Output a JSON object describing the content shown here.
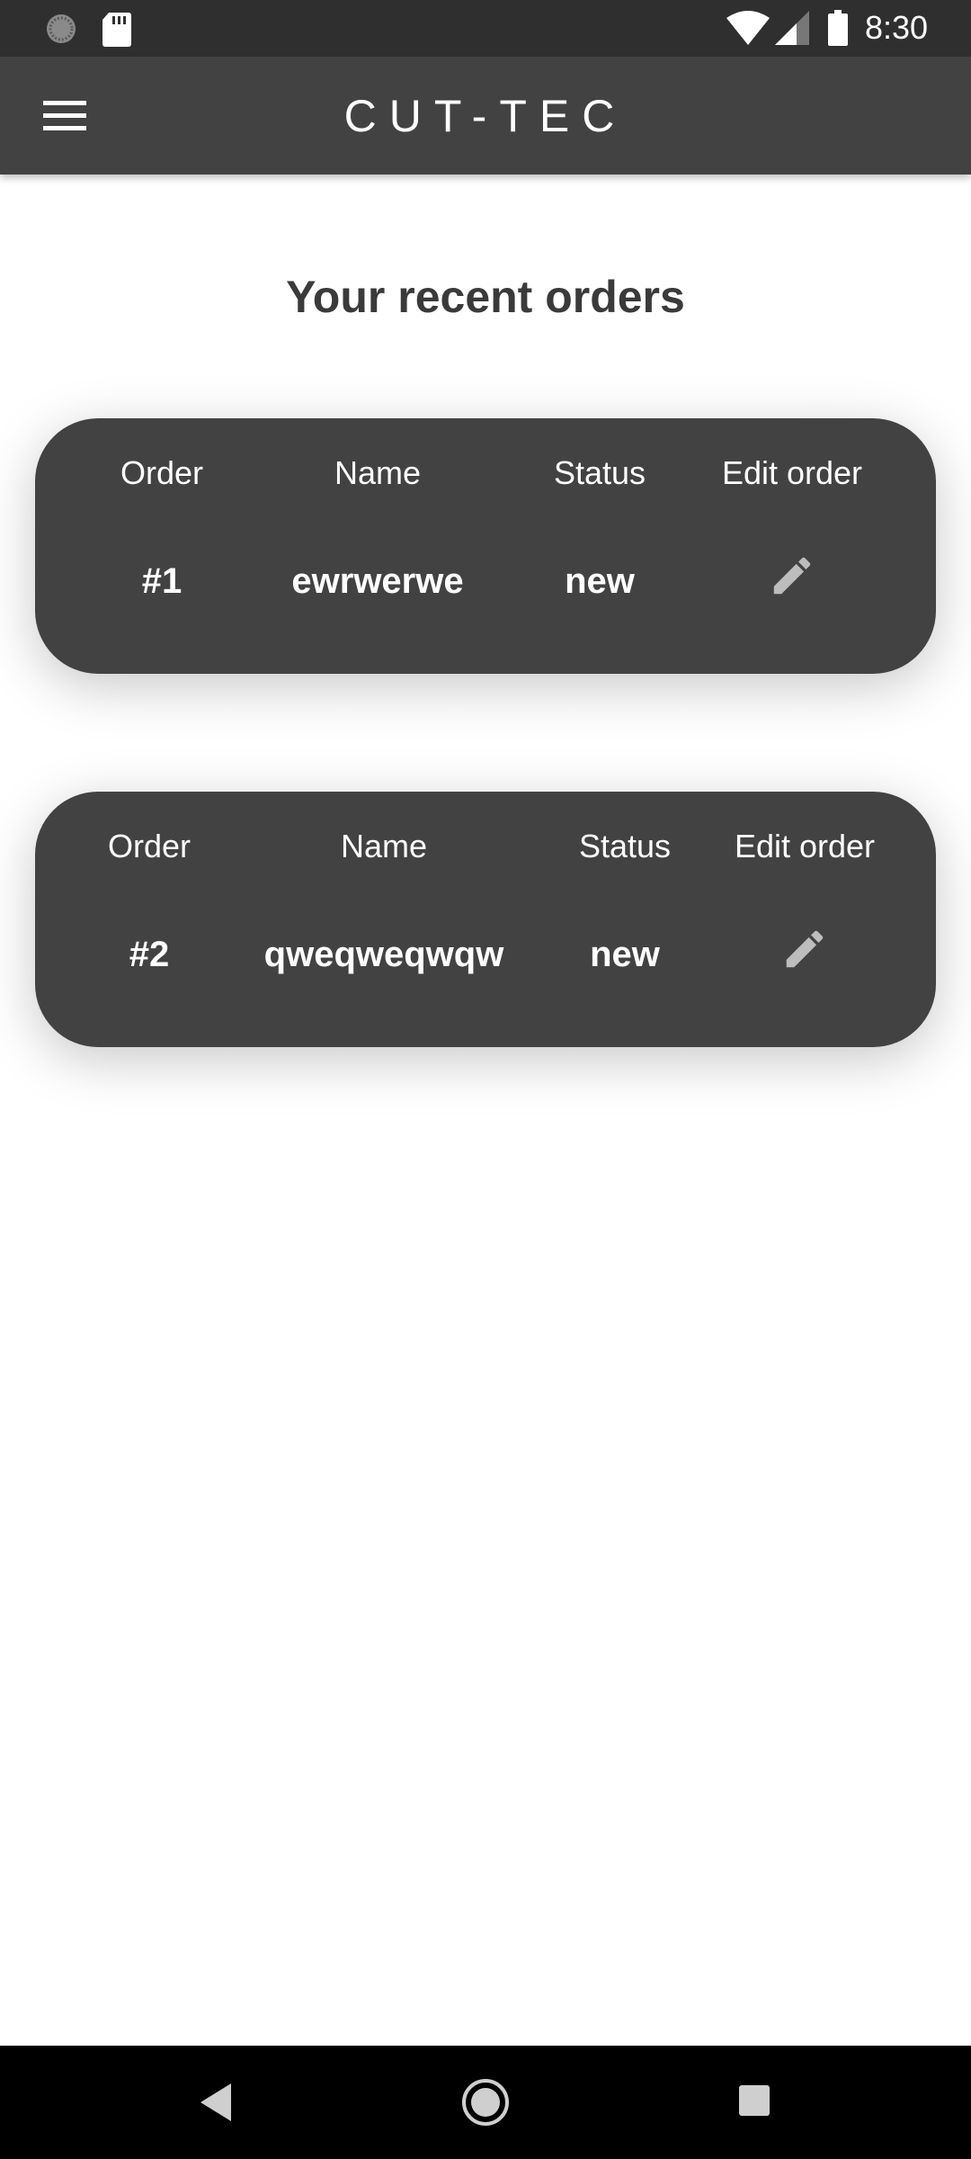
{
  "status_bar": {
    "time": "8:30"
  },
  "app_bar": {
    "title": "CUT-TEC",
    "menu_icon": "hamburger-menu-icon"
  },
  "page": {
    "heading": "Your recent orders"
  },
  "orders": {
    "headers": {
      "order": "Order",
      "name": "Name",
      "status": "Status",
      "edit": "Edit order"
    },
    "items": [
      {
        "order": "#1",
        "name": "ewrwerwe",
        "status": "new"
      },
      {
        "order": "#2",
        "name": "qweqweqwqw",
        "status": "new"
      }
    ]
  },
  "colors": {
    "app_bar": "#424242",
    "status_bar": "#2f2f2f",
    "card": "#424242",
    "heading": "#3a3a3a",
    "edit_icon": "#bdbdbd"
  },
  "nav_bar": {
    "icons": [
      "back-icon",
      "home-icon",
      "recents-icon"
    ]
  }
}
